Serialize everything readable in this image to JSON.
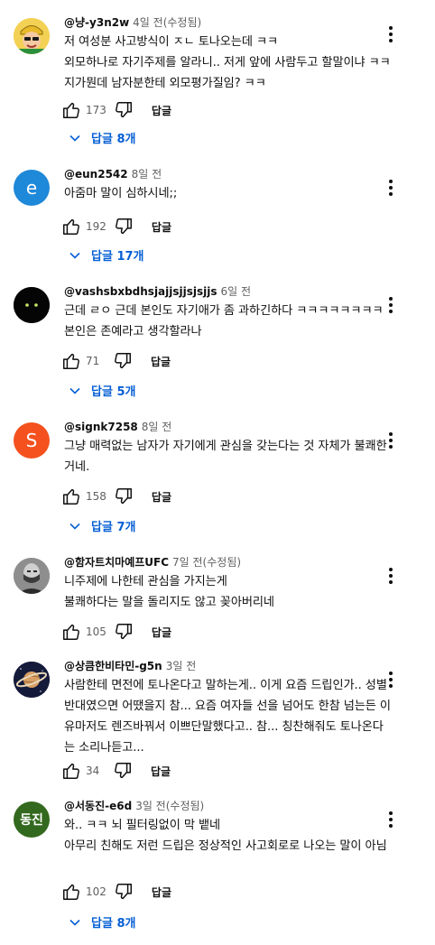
{
  "colors": {
    "accent_blue": "#065fd4",
    "muted_text": "#606060",
    "avatar_eun": "#1e88d9",
    "avatar_signk": "#f4511e",
    "avatar_seodongjin": "#33691e"
  },
  "comments": [
    {
      "author": "@냥-y3n2w",
      "time": "4일 전(수정됨)",
      "text": "저 여성분 사고방식이 ㅈㄴ 토나오는데 ㅋㅋ\n외모하나로 자기주제를 알라니..  저게 앞에 사람두고 할말이냐 ㅋㅋ 지가뭔데 남자분한테 외모평가질임? ㅋㅋ",
      "likes": "173",
      "reply_label": "답글",
      "replies_label": "답글 8개",
      "avatar_icon": "cartoon-avatar-icon"
    },
    {
      "author": "@eun2542",
      "time": "8일 전",
      "text": "아줌마 말이 심하시네;;",
      "likes": "192",
      "reply_label": "답글",
      "replies_label": "답글 17개",
      "avatar_letter": "e"
    },
    {
      "author": "@vashsbxbdhsjajjsjjsjsjjs",
      "time": "6일 전",
      "text": "근데 ㄹㅇ 근데 본인도 자기애가 좀 과하긴하다 ㅋㅋㅋㅋㅋㅋㅋㅋ 본인은 존예라고 생각할라나",
      "likes": "71",
      "reply_label": "답글",
      "replies_label": "답글 5개",
      "avatar_icon": "dark-eyes-avatar-icon"
    },
    {
      "author": "@signk7258",
      "time": "8일 전",
      "text": "그냥 매력없는 남자가 자기에게 관심을 갖는다는 것 자체가 불쾌한거네.",
      "likes": "158",
      "reply_label": "답글",
      "replies_label": "답글 7개",
      "avatar_letter": "S"
    },
    {
      "author": "@함자트치마예프UFC",
      "time": "7일 전(수정됨)",
      "text": "니주제에 나한테 관심을 가지는게\n불쾌하다는 말을 돌리지도 않고 꽂아버리네",
      "likes": "105",
      "reply_label": "답글",
      "avatar_icon": "fighter-photo-avatar-icon"
    },
    {
      "author": "@상큼한비타민-g5n",
      "time": "3일 전",
      "text": "사람한테 면전에 토나온다고 말하는게.. 이게 요즘 드립인가.. 성별 반대였으면 어땠을지 참... 요즘 여자들 선을 넘어도 한참 넘는든 이유마저도 렌즈바꿔서 이쁘단말했다고.. 참... 칭찬해줘도 토나온다는 소리나듣고...",
      "likes": "34",
      "reply_label": "답글",
      "avatar_icon": "saturn-avatar-icon"
    },
    {
      "author": "@서동진-e6d",
      "time": "3일 전(수정됨)",
      "text": "와.. ㅋㅋ 뇌 필터링없이 막 뱉네\n아무리 친해도 저런 드립은 정상적인 사고회로로 나오는 말이 아님",
      "likes": "102",
      "reply_label": "답글",
      "replies_label": "답글 8개",
      "avatar_letter": "동진"
    }
  ]
}
